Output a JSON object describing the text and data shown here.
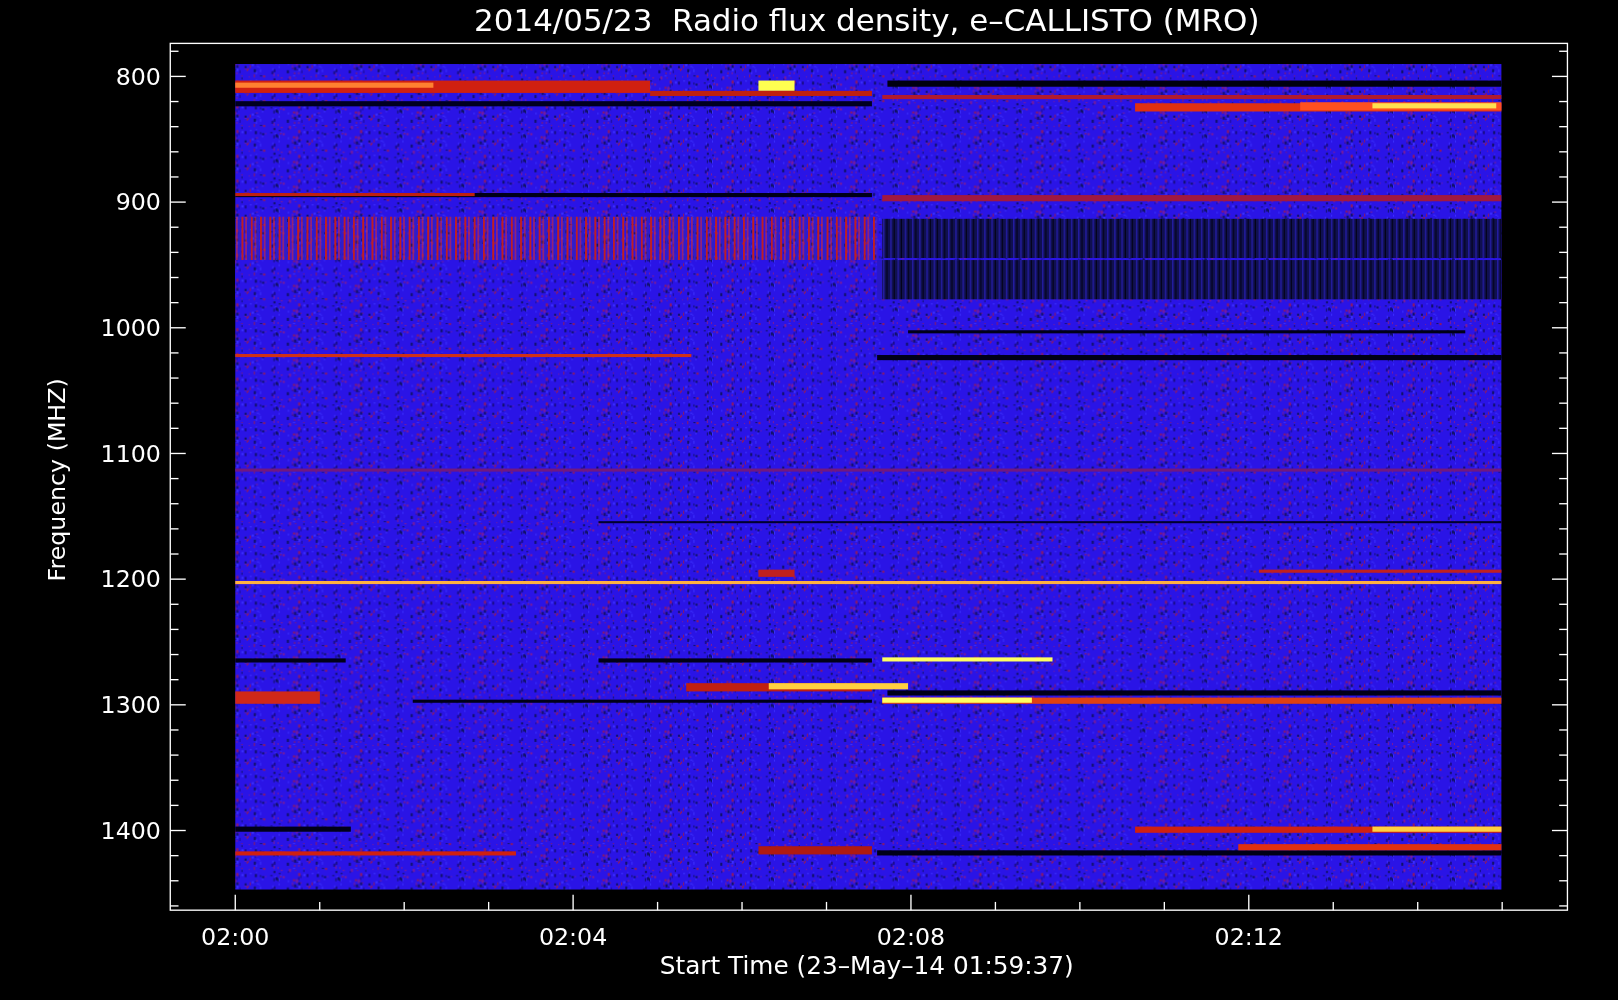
{
  "plot": {
    "title": "2014/05/23  Radio flux density, e–CALLISTO (MRO)",
    "y_axis": {
      "label": "Frequency (MHZ)",
      "ticks": [
        "800",
        "900",
        "1000",
        "1100",
        "1200",
        "1300",
        "1400"
      ]
    },
    "x_axis": {
      "label": "Start Time (23–May–14 01:59:37)",
      "ticks": [
        "02:00",
        "02:04",
        "02:08",
        "02:12"
      ]
    }
  }
}
